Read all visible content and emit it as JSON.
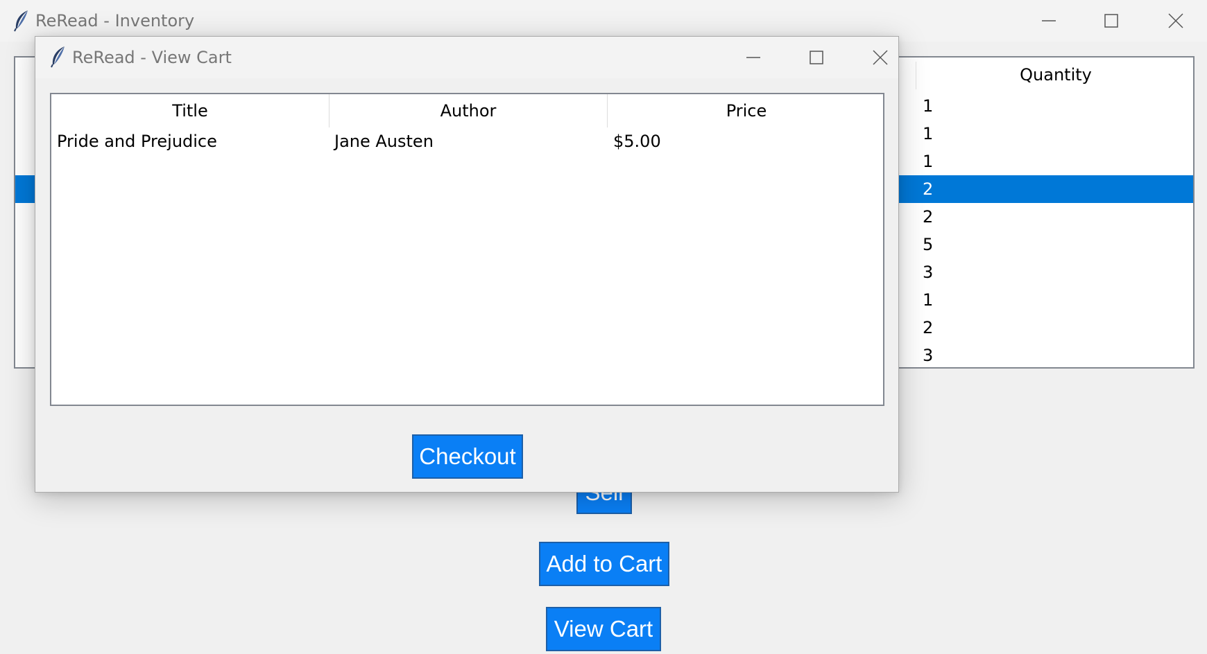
{
  "main_window": {
    "title": "ReRead - Inventory",
    "table": {
      "visible_column_header": "Quantity",
      "quantities": [
        "1",
        "1",
        "1",
        "2",
        "2",
        "5",
        "3",
        "1",
        "2",
        "3"
      ],
      "selected_row_index": 3
    },
    "buttons": {
      "sell": "Sell",
      "add_to_cart": "Add to Cart",
      "view_cart": "View Cart"
    }
  },
  "cart_window": {
    "title": "ReRead - View Cart",
    "table": {
      "columns": [
        "Title",
        "Author",
        "Price"
      ],
      "rows": [
        {
          "title": "Pride and Prejudice",
          "author": "Jane Austen",
          "price": "$5.00"
        }
      ]
    },
    "checkout_label": "Checkout"
  },
  "colors": {
    "button_blue": "#0a7ff5",
    "selection_blue": "#0078d7",
    "window_bg": "#f0f0f0"
  },
  "icons": {
    "app_icon": "feather-icon",
    "minimize": "minimize-icon",
    "maximize": "maximize-icon",
    "close": "close-icon"
  }
}
